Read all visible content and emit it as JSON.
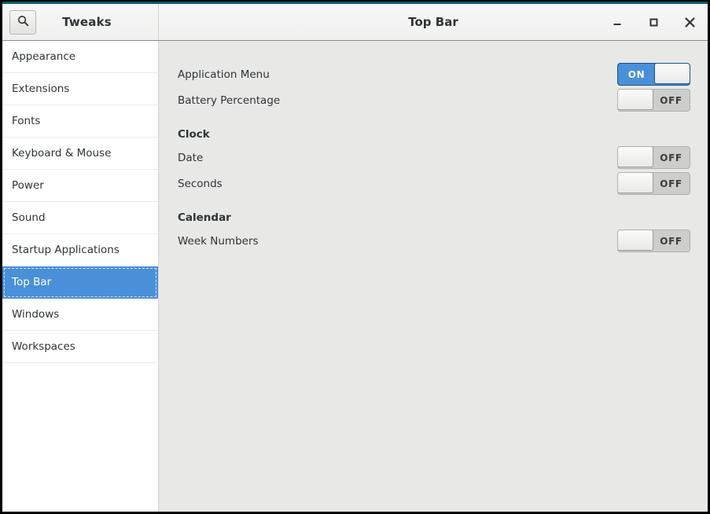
{
  "window": {
    "app_title": "Tweaks",
    "view_title": "Top Bar",
    "controls": {
      "minimize": "minimize-icon",
      "maximize": "maximize-icon",
      "close": "close-icon"
    },
    "search_icon": "search-icon"
  },
  "sidebar": {
    "selected": "Top Bar",
    "items": [
      {
        "label": "Appearance"
      },
      {
        "label": "Extensions"
      },
      {
        "label": "Fonts"
      },
      {
        "label": "Keyboard & Mouse"
      },
      {
        "label": "Power"
      },
      {
        "label": "Sound"
      },
      {
        "label": "Startup Applications"
      },
      {
        "label": "Top Bar"
      },
      {
        "label": "Windows"
      },
      {
        "label": "Workspaces"
      }
    ]
  },
  "content": {
    "rows": [
      {
        "label": "Application Menu",
        "state": "ON"
      },
      {
        "label": "Battery Percentage",
        "state": "OFF"
      }
    ],
    "sections": [
      {
        "title": "Clock",
        "rows": [
          {
            "label": "Date",
            "state": "OFF"
          },
          {
            "label": "Seconds",
            "state": "OFF"
          }
        ]
      },
      {
        "title": "Calendar",
        "rows": [
          {
            "label": "Week Numbers",
            "state": "OFF"
          }
        ]
      }
    ]
  },
  "colors": {
    "accent_blue": "#4a90d9",
    "content_bg": "#e8e8e7",
    "sidebar_bg": "#ffffff",
    "header_bg": "#f0f0ef",
    "top_accent": "#0b5c6e"
  }
}
